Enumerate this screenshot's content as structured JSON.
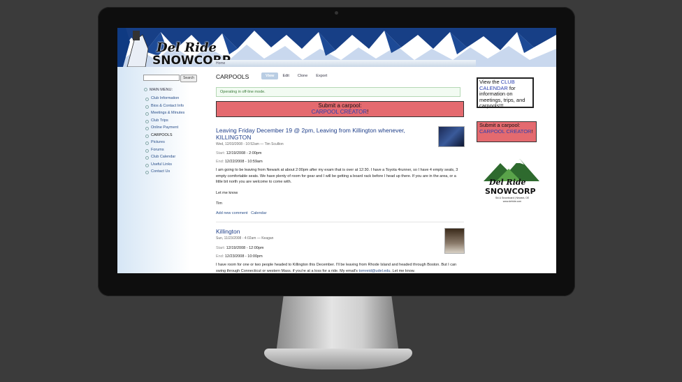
{
  "site": {
    "logo_script": "Del Ride",
    "logo_block": "SNOWCORP",
    "logo_tagline": "Ski & Snowboard | Newark, DE",
    "logo_url": "www.delride.com"
  },
  "breadcrumb": "Home",
  "search": {
    "button": "Search",
    "placeholder": ""
  },
  "sidebar": {
    "heading": "MAIN MENU:",
    "items": [
      {
        "label": "Club Information"
      },
      {
        "label": "Bios & Contact Info"
      },
      {
        "label": "Meetings & Minutes"
      },
      {
        "label": "Club Trips"
      },
      {
        "label": "Online Payment"
      },
      {
        "label": "CARPOOLS"
      },
      {
        "label": "Pictures"
      },
      {
        "label": "Forums"
      },
      {
        "label": "Club Calendar"
      },
      {
        "label": "Useful Links"
      },
      {
        "label": "Contact Us"
      }
    ]
  },
  "page": {
    "title": "CARPOOLS",
    "tabs": [
      "View",
      "Edit",
      "Clone",
      "Export"
    ],
    "status": "Operating in off-line mode.",
    "submit_line1": "Submit a carpool:",
    "submit_link": "CARPOOL CREATOR",
    "submit_tail": "!"
  },
  "posts": [
    {
      "title": "Leaving Friday December 19 @ 2pm, Leaving from Killington whenever, KILLINGTON",
      "meta": "Wed, 12/03/2008 - 10:52am — Tim Scullion",
      "start_label": "Start:",
      "start": "12/19/2008 - 2:00pm",
      "end_label": "End:",
      "end": "12/22/2008 - 10:59am",
      "body": "I am going to be leaving from Newark at about 2:00pm after my exam that is over at 12:30. I have a Toyota 4runner, so I have 4 empty seats, 3 empty comfortable seats. We have plenty of room for gear and I will be getting a board rack before I head up there. If you are in the area, or a little bit north you are welcome to come with.",
      "line2": "Let me know",
      "sign": "Tim",
      "link_comment": "Add new comment",
      "link_calendar": "Calendar"
    },
    {
      "title": "Killington",
      "meta": "Sun, 11/23/2008 - 4:02am — Keagan",
      "start_label": "Start:",
      "start": "12/19/2008 - 12:00pm",
      "end_label": "End:",
      "end": "12/23/2008 - 10:00pm",
      "body_a": "I have room for one or two people headed to Killington this December. I'll be leaving from Rhode Island and headed through Boston. But I can swing through Connecticut or western Mass. if you're at a loss for a ride. My email's ",
      "body_email": "tomreid@udel.edu",
      "body_b": ". Let me know."
    }
  ],
  "right": {
    "cal_a": "View the ",
    "cal_link": "CLUB CALENDAR",
    "cal_b": " for information on meetings, trips, and carpools!!!",
    "submit_line1": "Submit a carpool:",
    "submit_link": "CARPOOL CREATOR",
    "submit_tail": "!"
  }
}
